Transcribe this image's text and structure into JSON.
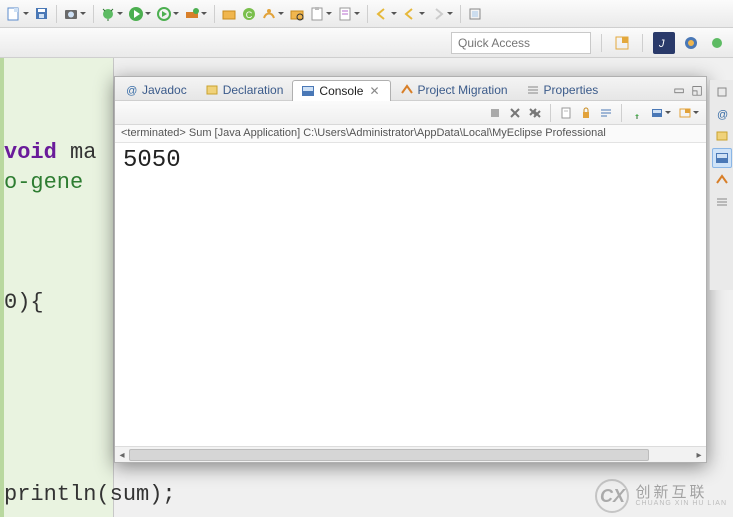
{
  "toolbar": {
    "new_menu": "New",
    "save_all": "Save All",
    "camera": "Screenshot",
    "debug": "Debug",
    "run": "Run",
    "run_last": "Run Last",
    "ext_tools": "External Tools",
    "new_pkg": "New Package",
    "new_class": "New Class",
    "open_type": "Open Type",
    "search": "Search",
    "task": "New Task",
    "annotations": "Annotations",
    "back": "Back",
    "forward": "Forward",
    "pin": "Pin Editor",
    "scrapbook": "Scrapbook"
  },
  "quick_access": {
    "placeholder": "Quick Access"
  },
  "tabs": {
    "javadoc": "Javadoc",
    "declaration": "Declaration",
    "console": "Console",
    "project_migration": "Project Migration",
    "properties": "Properties"
  },
  "console": {
    "status": "<terminated> Sum [Java Application] C:\\Users\\Administrator\\AppData\\Local\\MyEclipse Professional",
    "output": "5050"
  },
  "editor": {
    "line1_kw": "void",
    "line1_rest": " ma",
    "line2": "o-gene",
    "line3": "0){",
    "line_bottom": "println(sum);"
  },
  "watermark": {
    "logo": "CX",
    "cn": "创新互联",
    "py": "CHUANG XIN HU LIAN"
  }
}
